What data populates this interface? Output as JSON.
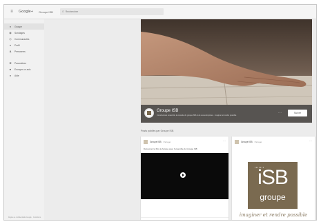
{
  "topbar": {
    "logo": "Google+",
    "page_label": "Groupe ISB",
    "search": {
      "placeholder": "Rechercher"
    }
  },
  "sidebar": {
    "items": [
      {
        "label": "Groupe",
        "icon": "people-icon"
      },
      {
        "label": "Sondages",
        "icon": "poll-icon"
      },
      {
        "label": "Communautés",
        "icon": "community-icon"
      },
      {
        "label": "Profil",
        "icon": "profile-icon"
      },
      {
        "label": "Personnes",
        "icon": "person-icon"
      }
    ],
    "secondary_items": [
      {
        "label": "Paramètres",
        "icon": "gear-icon"
      },
      {
        "label": "Envoyer un avis",
        "icon": "feedback-icon"
      },
      {
        "label": "Aide",
        "icon": "help-icon"
      }
    ],
    "footer": "Règles et confidentialité Google · Conditions"
  },
  "cover": {
    "title": "Groupe ISB",
    "tagline": "Construisons ensemble la réussite du groupe ISB et de ses entreprises · imaginer et rendre possible",
    "follow_label": "Suivre",
    "more": "⋯"
  },
  "posts_heading": "Posts publiés par Groupe ISB",
  "posts": [
    {
      "author": "Groupe ISB",
      "date": "Partagé",
      "text": "Découvrez le film de l'année avec l'ensemble du Groupe ISB",
      "menu": "⋯"
    },
    {
      "author": "Groupe ISB",
      "date": "Partagé",
      "menu": "⋯",
      "logo_main": "iSB",
      "logo_sub": "groupe",
      "logo_tagline": "imaginer et rendre possible"
    }
  ],
  "colors": {
    "brand": "#7a6a50",
    "video_bg": "#0a0a0a",
    "sidebar_bg": "#f1f1f1"
  }
}
